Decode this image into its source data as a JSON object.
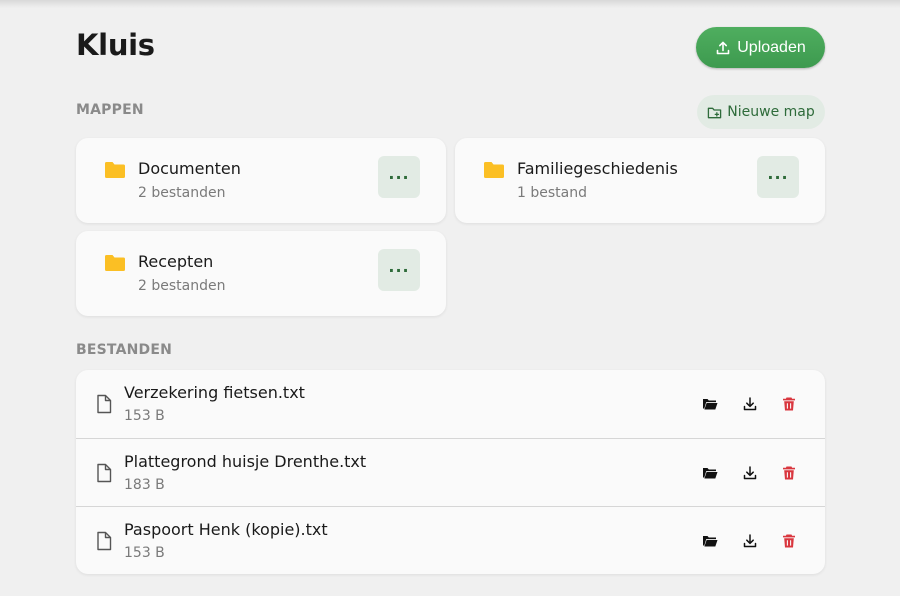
{
  "header": {
    "title": "Kluis",
    "upload_label": "Uploaden"
  },
  "folders_section": {
    "title": "MAPPEN",
    "new_folder_label": "Nieuwe map",
    "items": [
      {
        "name": "Documenten",
        "count": "2 bestanden"
      },
      {
        "name": "Familiegeschiedenis",
        "count": "1 bestand"
      },
      {
        "name": "Recepten",
        "count": "2 bestanden"
      }
    ],
    "more_label": "···"
  },
  "files_section": {
    "title": "BESTANDEN",
    "items": [
      {
        "name": "Verzekering fietsen.txt",
        "size": "153 B"
      },
      {
        "name": "Plattegrond huisje Drenthe.txt",
        "size": "183 B"
      },
      {
        "name": "Paspoort Henk (kopie).txt",
        "size": "153 B"
      }
    ]
  },
  "colors": {
    "accent": "#43a356",
    "accent_soft": "#e2ebe4",
    "folder": "#fbbf24",
    "danger": "#d9363e",
    "background": "#f0f0f0",
    "card": "#fafafa"
  },
  "icons": {
    "upload": "upload-icon",
    "new_folder": "folder-plus-icon",
    "folder": "folder-icon",
    "file": "file-icon",
    "move": "folder-open-icon",
    "download": "download-icon",
    "delete": "trash-icon"
  }
}
